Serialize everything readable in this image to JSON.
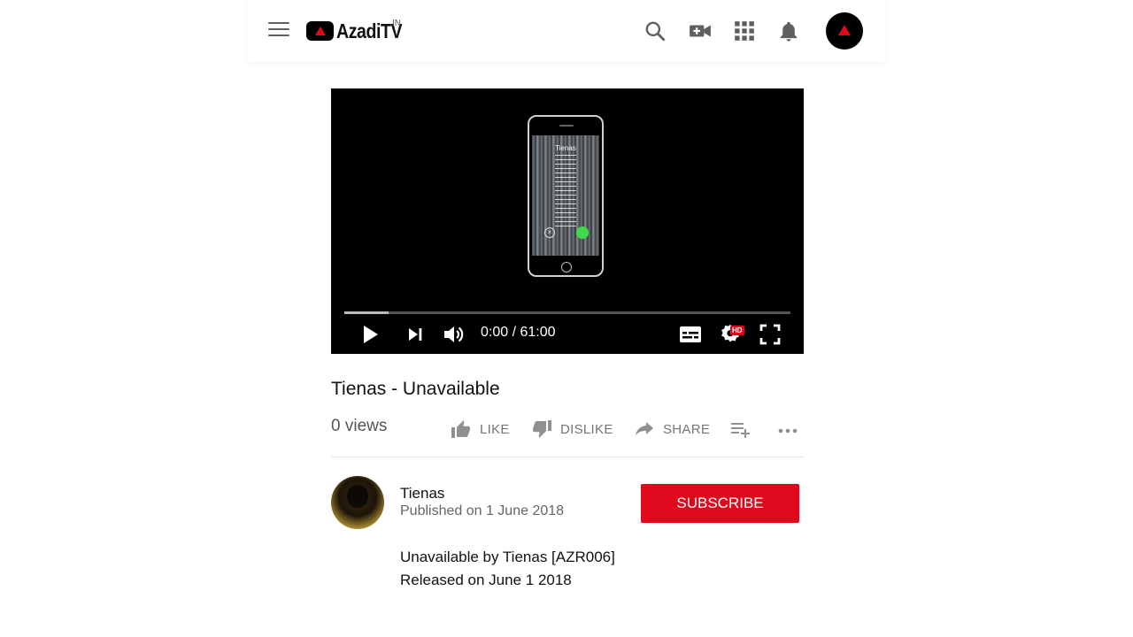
{
  "header": {
    "brand": "AzadiTV",
    "region": "IN"
  },
  "player": {
    "time_display": "0:00 / 61:00",
    "progress_buffered": 0.1,
    "quality_badge": "HD",
    "thumbnail_title": "Tienas"
  },
  "video": {
    "title": "Tienas - Unavailable",
    "views": "0 views"
  },
  "actions": {
    "like": "LIKE",
    "dislike": "DISLIKE",
    "share": "SHARE"
  },
  "channel": {
    "name": "Tienas",
    "published": "Published on 1 June 2018",
    "subscribe_label": "SUBSCRIBE"
  },
  "description": {
    "line1": "Unavailable by Tienas [AZR006]",
    "line2": "Released on June 1 2018"
  },
  "colors": {
    "brand_red": "#e0081c",
    "icon_gray": "#606060"
  },
  "icons": [
    "menu-icon",
    "search-icon",
    "video-camera-add-icon",
    "apps-grid-icon",
    "bell-icon",
    "play-icon",
    "next-icon",
    "volume-icon",
    "subtitles-icon",
    "settings-icon",
    "fullscreen-icon",
    "thumbs-up-icon",
    "thumbs-down-icon",
    "share-arrow-icon",
    "add-to-playlist-icon",
    "more-icon"
  ]
}
